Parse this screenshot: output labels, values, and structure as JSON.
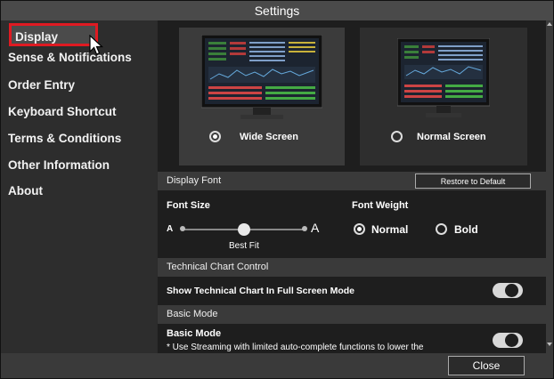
{
  "window": {
    "title": "Settings"
  },
  "sidebar": {
    "items": [
      {
        "label": "Display"
      },
      {
        "label": "Sense & Notifications"
      },
      {
        "label": "Order Entry"
      },
      {
        "label": "Keyboard Shortcut"
      },
      {
        "label": "Terms & Conditions"
      },
      {
        "label": "Other Information"
      },
      {
        "label": "About"
      }
    ]
  },
  "display": {
    "screen_options": [
      {
        "label": "Wide Screen",
        "selected": true
      },
      {
        "label": "Normal Screen",
        "selected": false
      }
    ],
    "font_section_title": "Display Font",
    "restore_label": "Restore to Default",
    "font_size_label": "Font Size",
    "size_small_glyph": "A",
    "size_large_glyph": "A",
    "size_value_label": "Best Fit",
    "font_size_step": 2,
    "font_size_steps_total": 4,
    "font_weight_label": "Font Weight",
    "weight_options": [
      {
        "label": "Normal",
        "selected": true
      },
      {
        "label": "Bold",
        "selected": false
      }
    ],
    "technical_section_title": "Technical Chart Control",
    "technical_fullscreen_label": "Show Technical Chart In Full Screen Mode",
    "technical_fullscreen_on": false,
    "basic_section_title": "Basic Mode",
    "basic_mode_label": "Basic Mode",
    "basic_mode_desc": "* Use Streaming with limited auto-complete functions to lower the",
    "basic_mode_on": false
  },
  "footer": {
    "close_label": "Close"
  },
  "colors": {
    "highlight": "#e01a22",
    "panel": "#1e1e1e",
    "sidebar": "#2d2d2d"
  }
}
